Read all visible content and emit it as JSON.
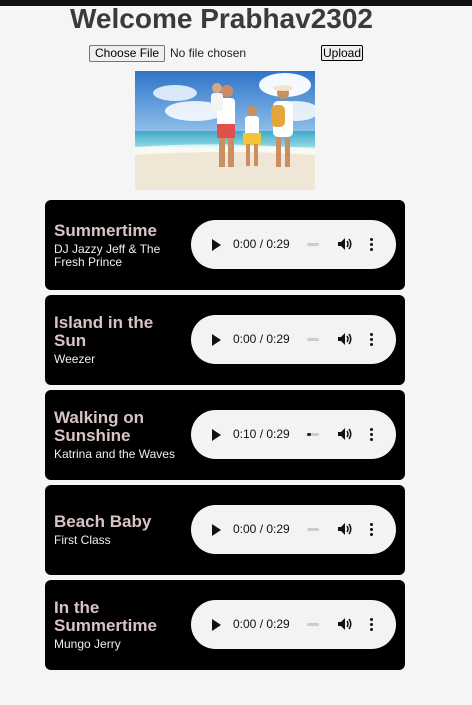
{
  "header": {
    "welcome": "Welcome Prabhav2302"
  },
  "upload": {
    "choose_label": "Choose File",
    "status": "No file chosen",
    "upload_label": "Upload"
  },
  "songs": [
    {
      "title": "Summertime",
      "artist": "DJ Jazzy Jeff & The Fresh Prince",
      "time": "0:00 / 0:29",
      "progress": 0
    },
    {
      "title": "Island in the Sun",
      "artist": "Weezer",
      "time": "0:00 / 0:29",
      "progress": 0
    },
    {
      "title": "Walking on Sunshine",
      "artist": "Katrina and the Waves",
      "time": "0:10 / 0:29",
      "progress": 0.34
    },
    {
      "title": "Beach Baby",
      "artist": "First Class",
      "time": "0:00 / 0:29",
      "progress": 0
    },
    {
      "title": "In the Summertime",
      "artist": "Mungo Jerry",
      "time": "0:00 / 0:29",
      "progress": 0
    }
  ],
  "icons": {
    "play": "play-icon",
    "volume": "volume-icon",
    "more": "more-options-icon"
  },
  "colors": {
    "card_bg": "#000000",
    "title": "#d9c3c3",
    "player_bg": "#f1f3f4"
  }
}
